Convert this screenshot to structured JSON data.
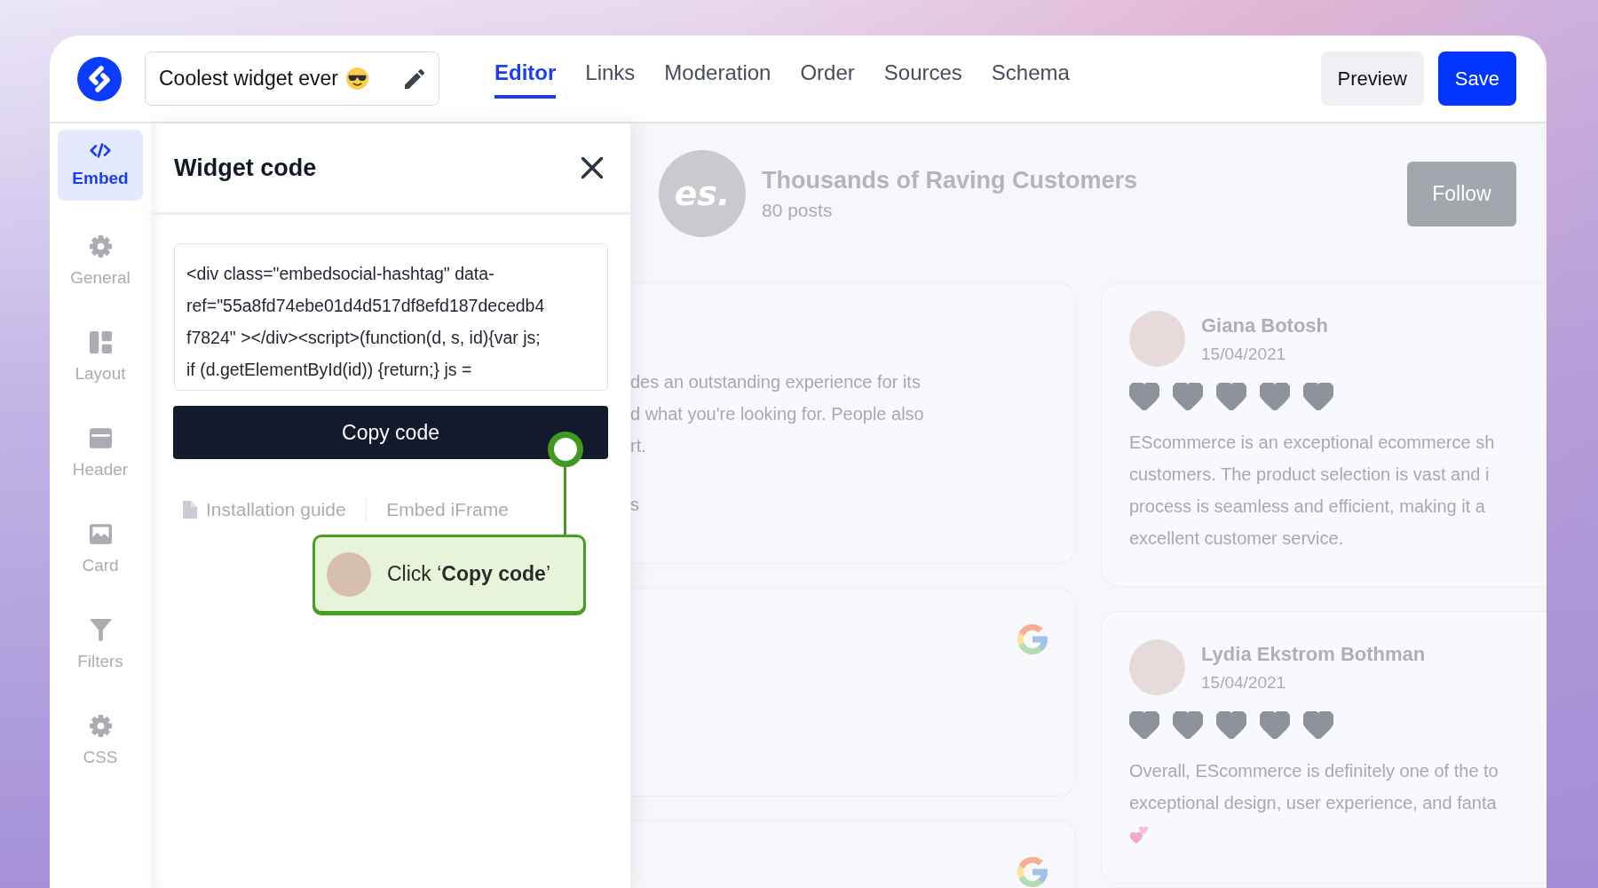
{
  "header": {
    "widget_name": "Coolest widget ever",
    "tabs": [
      {
        "label": "Editor",
        "selected": true
      },
      {
        "label": "Links",
        "selected": false
      },
      {
        "label": "Moderation",
        "selected": false
      },
      {
        "label": "Order",
        "selected": false
      },
      {
        "label": "Sources",
        "selected": false
      },
      {
        "label": "Schema",
        "selected": false
      }
    ],
    "buttons": [
      {
        "label": "Preview",
        "kind": "secondary"
      },
      {
        "label": "Save",
        "kind": "primary"
      }
    ]
  },
  "sidebar": {
    "items": [
      {
        "label": "Embed",
        "selected": true
      },
      {
        "label": "General",
        "selected": false
      },
      {
        "label": "Layout",
        "selected": false
      },
      {
        "label": "Header",
        "selected": false
      },
      {
        "label": "Card",
        "selected": false
      },
      {
        "label": "Filters",
        "selected": false
      },
      {
        "label": "CSS",
        "selected": false
      }
    ]
  },
  "panel": {
    "title": "Widget code",
    "code_lines": [
      "<div class=\"embedsocial-hashtag\" data-",
      "ref=\"55a8fd74ebe01d4d517df8efd187decedb4",
      "f7824\" ></div><script>(function(d, s, id){var js;",
      "if (d.getElementById(id)) {return;} js ="
    ],
    "copy_button": "Copy code",
    "links": [
      "Installation guide",
      "Embed iFrame"
    ]
  },
  "tooltip": {
    "text": "Click ‘**Copy code**’"
  },
  "preview": {
    "profile": {
      "avatar_text": "es.",
      "name": "Thousands of Raving Customers",
      "posts": "80 posts",
      "follow_button": "Follow"
    },
    "left_cards": [
      {
        "lines": [
          "des an outstanding experience for its",
          "d what you're looking for. People also",
          "rt."
        ],
        "footer": "s",
        "source_badge": false
      },
      {
        "source_badge": true
      },
      {
        "source_badge": true
      }
    ],
    "right_cards": [
      {
        "name": "Giana Botosh",
        "date": "15/04/2021",
        "stars": 5,
        "lines": [
          "EScommerce is an exceptional ecommerce sh",
          "customers. The product selection is vast and i",
          "process is seamless and efficient, making it a",
          "excellent customer service."
        ],
        "emoji": false
      },
      {
        "name": "Lydia Ekstrom Bothman",
        "date": "15/04/2021",
        "stars": 5,
        "lines": [
          "Overall, EScommerce is definitely one of the to",
          "exceptional design, user experience, and fanta"
        ],
        "emoji": true
      }
    ]
  }
}
